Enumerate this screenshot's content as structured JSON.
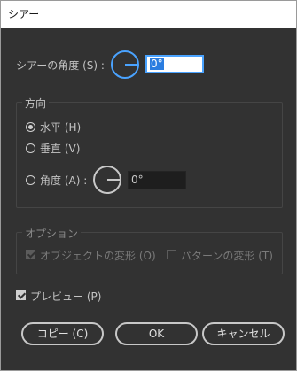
{
  "window": {
    "title": "シアー"
  },
  "shear_angle": {
    "label": "シアーの角度 (S) :",
    "value": "0°"
  },
  "direction": {
    "title": "方向",
    "options": [
      {
        "label": "水平 (H)",
        "selected": true
      },
      {
        "label": "垂直 (V)",
        "selected": false
      },
      {
        "label": "角度 (A) :",
        "selected": false
      }
    ],
    "angle_value": "0°"
  },
  "options": {
    "title": "オプション",
    "transform_objects": {
      "label": "オブジェクトの変形 (O)",
      "checked": true,
      "enabled": false
    },
    "transform_patterns": {
      "label": "パターンの変形 (T)",
      "checked": false,
      "enabled": false
    }
  },
  "preview": {
    "label": "プレビュー (P)",
    "checked": true
  },
  "buttons": {
    "copy": "コピー (C)",
    "ok": "OK",
    "cancel": "キャンセル"
  }
}
